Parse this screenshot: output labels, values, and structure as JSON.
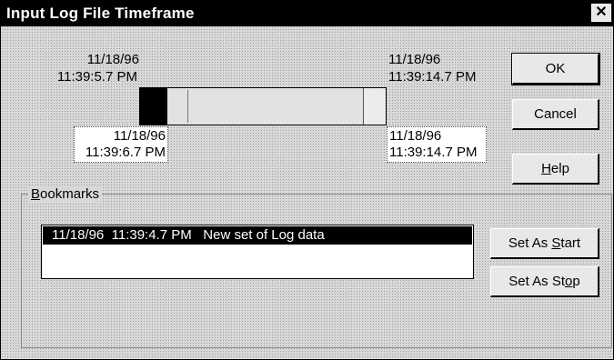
{
  "window": {
    "title": "Input Log File Timeframe",
    "close_glyph": "✕"
  },
  "timeframe": {
    "log_start": {
      "date": "11/18/96",
      "time": "11:39:5.7 PM"
    },
    "log_end": {
      "date": "11/18/96",
      "time": "11:39:14.7 PM"
    },
    "selected_start": {
      "date": "11/18/96",
      "time": "11:39:6.7 PM"
    },
    "selected_end": {
      "date": "11/18/96",
      "time": "11:39:14.7 PM"
    }
  },
  "buttons": {
    "ok": "OK",
    "cancel": "Cancel",
    "help_prefix": "",
    "help_mnemonic": "H",
    "help_suffix": "elp",
    "set_start_prefix": "Set As ",
    "set_start_mnemonic": "S",
    "set_start_suffix": "tart",
    "set_stop_prefix": "Set As St",
    "set_stop_mnemonic": "o",
    "set_stop_suffix": "p"
  },
  "bookmarks": {
    "label_mnemonic": "B",
    "label_rest": "ookmarks",
    "items": [
      {
        "date": "11/18/96",
        "time": "11:39:4.7 PM",
        "description": "New set of Log data"
      }
    ]
  },
  "icons": {
    "close": "close-icon"
  },
  "colors": {
    "titlebar": "#000000",
    "selection": "#000000",
    "face": "#d8d8d8"
  }
}
